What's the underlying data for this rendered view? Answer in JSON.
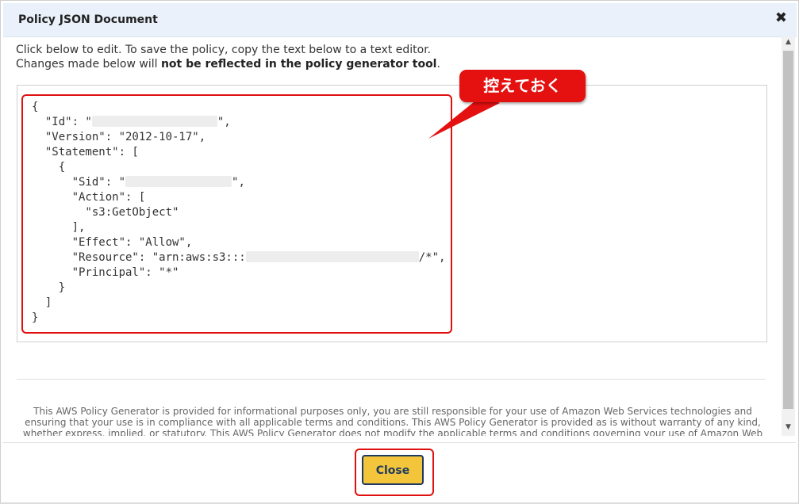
{
  "dialog": {
    "title": "Policy JSON Document",
    "close_glyph": "✖"
  },
  "intro": {
    "line1": "Click below to edit. To save the policy, copy the text below to a text editor.",
    "line2_prefix": "Changes made below will ",
    "line2_bold": "not be reflected in the policy generator tool",
    "line2_suffix": "."
  },
  "policy": {
    "l1": "{",
    "l2_a": "  \"Id\": \"",
    "l2_b": "\",",
    "l3": "  \"Version\": \"2012-10-17\",",
    "l4": "  \"Statement\": [",
    "l5": "    {",
    "l6_a": "      \"Sid\": \"",
    "l6_b": "\",",
    "l7": "      \"Action\": [",
    "l8": "        \"s3:GetObject\"",
    "l9": "      ],",
    "l10": "      \"Effect\": \"Allow\",",
    "l11_a": "      \"Resource\": \"arn:aws:s3:::",
    "l11_b": "/*\",",
    "l12": "      \"Principal\": \"*\"",
    "l13": "    }",
    "l14": "  ]",
    "l15": "}"
  },
  "callout": {
    "text": "控えておく"
  },
  "disclaimer": "This AWS Policy Generator is provided for informational purposes only, you are still responsible for your use of Amazon Web Services technologies and ensuring that your use is in compliance with all applicable terms and conditions. This AWS Policy Generator is provided as is without warranty of any kind, whether express, implied, or statutory. This AWS Policy Generator does not modify the applicable terms and conditions governing your use of Amazon Web Services",
  "footer": {
    "close_label": "Close"
  },
  "colors": {
    "accent_red": "#e51010",
    "close_button": "#f2c53b",
    "title_bar": "#eaf1fb"
  }
}
